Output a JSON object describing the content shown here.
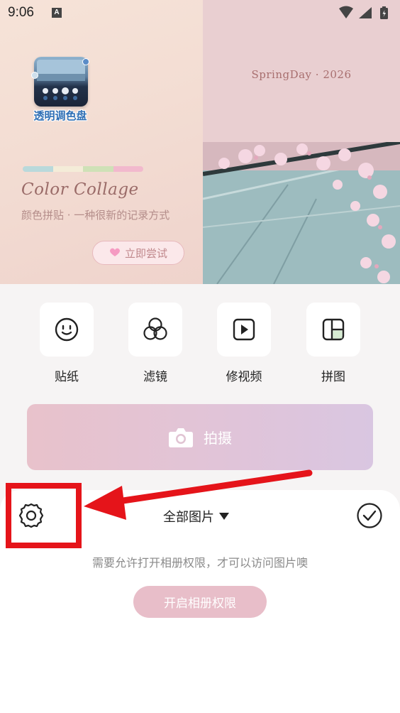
{
  "status_bar": {
    "time": "9:06",
    "notification_icon_letter": "A",
    "icons": [
      "wifi-icon",
      "signal-icon",
      "battery-charging-icon"
    ]
  },
  "banner": {
    "spring_day": "SpringDay · 2026",
    "app_badge_label": "透明调色盘",
    "color_strip": [
      "#b9d9db",
      "#f4ecd8",
      "#cfe1b7",
      "#f2b9cd"
    ],
    "title": "Color Collage",
    "subtitle": "颜色拼贴 · 一种很新的记录方式",
    "try_button": "立即尝试"
  },
  "tools": [
    {
      "label": "贴纸",
      "icon": "smiley-icon"
    },
    {
      "label": "滤镜",
      "icon": "filter-circles-icon"
    },
    {
      "label": "修视频",
      "icon": "video-play-icon"
    },
    {
      "label": "拼图",
      "icon": "collage-grid-icon"
    }
  ],
  "capture": {
    "label": "拍摄",
    "icon": "camera-icon"
  },
  "sheet": {
    "settings_icon": "gear-icon",
    "album_select": "全部图片",
    "confirm_icon": "check-circle-icon",
    "permission_text": "需要允许打开相册权限，才可以访问图片噢",
    "permission_button": "开启相册权限"
  },
  "colors": {
    "annotation_red": "#e5141a",
    "capture_gradient_start": "#e8c2cb",
    "capture_gradient_end": "#d9c6e1",
    "permission_button": "#e8bec9"
  }
}
